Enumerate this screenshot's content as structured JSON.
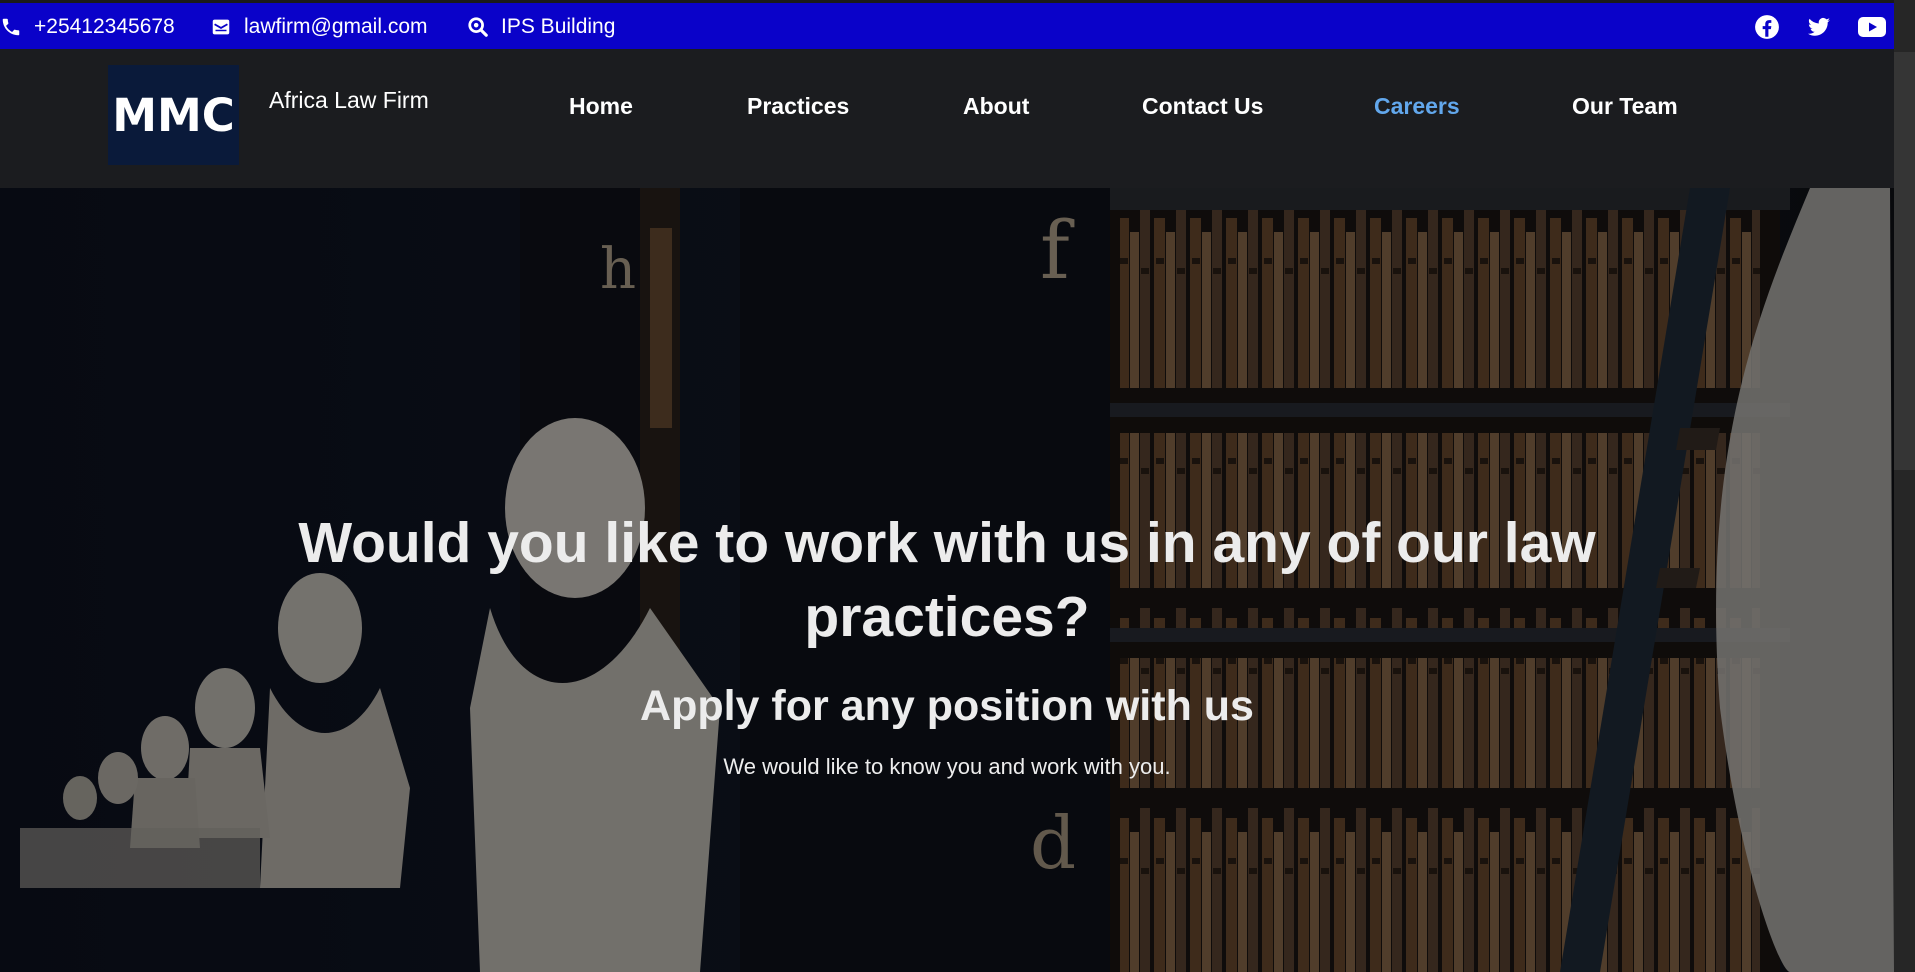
{
  "topbar": {
    "phone": "+25412345678",
    "email": "lawfirm@gmail.com",
    "location": "IPS Building",
    "icons": [
      "phone-icon",
      "envelope-icon",
      "search-location-icon",
      "facebook-icon",
      "twitter-icon",
      "youtube-icon"
    ]
  },
  "navbar": {
    "logo_text": "MMC",
    "brand": "Africa Law Firm",
    "links": [
      {
        "label": "Home"
      },
      {
        "label": "Practices"
      },
      {
        "label": "About"
      },
      {
        "label": "Contact Us"
      },
      {
        "label": "Careers",
        "active": true
      },
      {
        "label": "Our Team"
      }
    ]
  },
  "hero": {
    "heading": "Would you like to work with us in any of our law practices?",
    "subheading": "Apply for any position with us",
    "lead": "We would like to know you and work with you."
  },
  "colors": {
    "topbar": "#0a02c9",
    "navbar": "#1b1c1f",
    "active_link": "#62a7ec",
    "logo_bg": "#0a1a3a"
  }
}
